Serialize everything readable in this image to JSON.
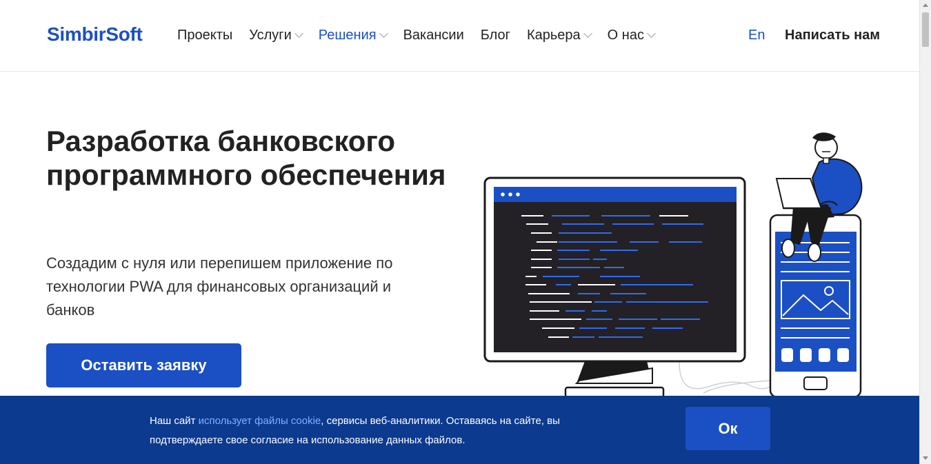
{
  "header": {
    "logo": "SimbirSoft",
    "nav": [
      {
        "label": "Проекты",
        "dropdown": false,
        "active": false
      },
      {
        "label": "Услуги",
        "dropdown": true,
        "active": false
      },
      {
        "label": "Решения",
        "dropdown": true,
        "active": true
      },
      {
        "label": "Вакансии",
        "dropdown": false,
        "active": false
      },
      {
        "label": "Блог",
        "dropdown": false,
        "active": false
      },
      {
        "label": "Карьера",
        "dropdown": true,
        "active": false
      },
      {
        "label": "О нас",
        "dropdown": true,
        "active": false
      }
    ],
    "lang": "En",
    "contact": "Написать нам"
  },
  "hero": {
    "title": "Разработка банковского программного обеспечения",
    "subtitle": "Создадим с нуля или перепишем приложение по технологии PWA для финансовых организаций и банков",
    "cta": "Оставить заявку"
  },
  "cookie": {
    "text_before": "Наш сайт ",
    "link": "использует файлы cookie",
    "text_after": ", сервисы веб-аналитики. Оставаясь на сайте, вы подтверждаете свое согласие на использование данных файлов.",
    "ok": "Ок"
  },
  "colors": {
    "brand": "#1b4fc4",
    "banner": "#0c3a8f",
    "text": "#222222"
  }
}
